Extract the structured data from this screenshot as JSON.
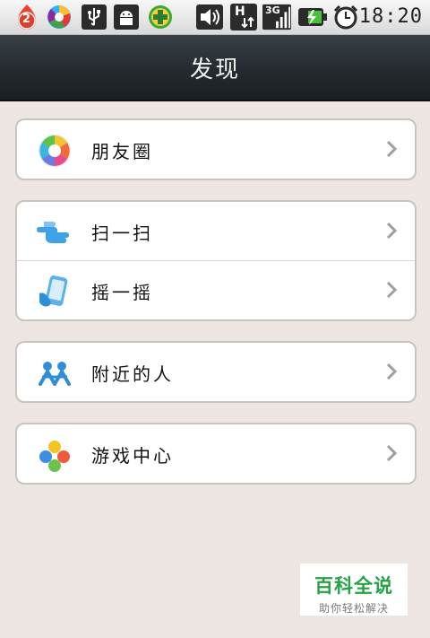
{
  "status_bar": {
    "notification_count": "2",
    "time": "18:20",
    "network_type": "H",
    "signal_label": "3G",
    "icons": [
      "notification-badge-icon",
      "app-store-icon",
      "usb-icon",
      "android-debug-icon",
      "security-plus-icon",
      "volume-icon",
      "hspa-data-icon",
      "signal-3g-icon",
      "battery-charging-icon",
      "alarm-clock-icon"
    ]
  },
  "header": {
    "title": "发现"
  },
  "groups": [
    {
      "items": [
        {
          "label": "朋友圈",
          "icon": "moments-aperture-icon"
        }
      ]
    },
    {
      "items": [
        {
          "label": "扫一扫",
          "icon": "scan-hand-icon"
        },
        {
          "label": "摇一摇",
          "icon": "shake-phone-icon"
        }
      ]
    },
    {
      "items": [
        {
          "label": "附近的人",
          "icon": "nearby-people-icon"
        }
      ]
    },
    {
      "items": [
        {
          "label": "游戏中心",
          "icon": "game-center-icon"
        }
      ]
    }
  ],
  "watermark": {
    "main": "百科全说",
    "sub": "助你轻松解决"
  },
  "colors": {
    "title_bar": "#242a2f",
    "background": "#ece5e2",
    "watermark_green": "#25a244"
  }
}
